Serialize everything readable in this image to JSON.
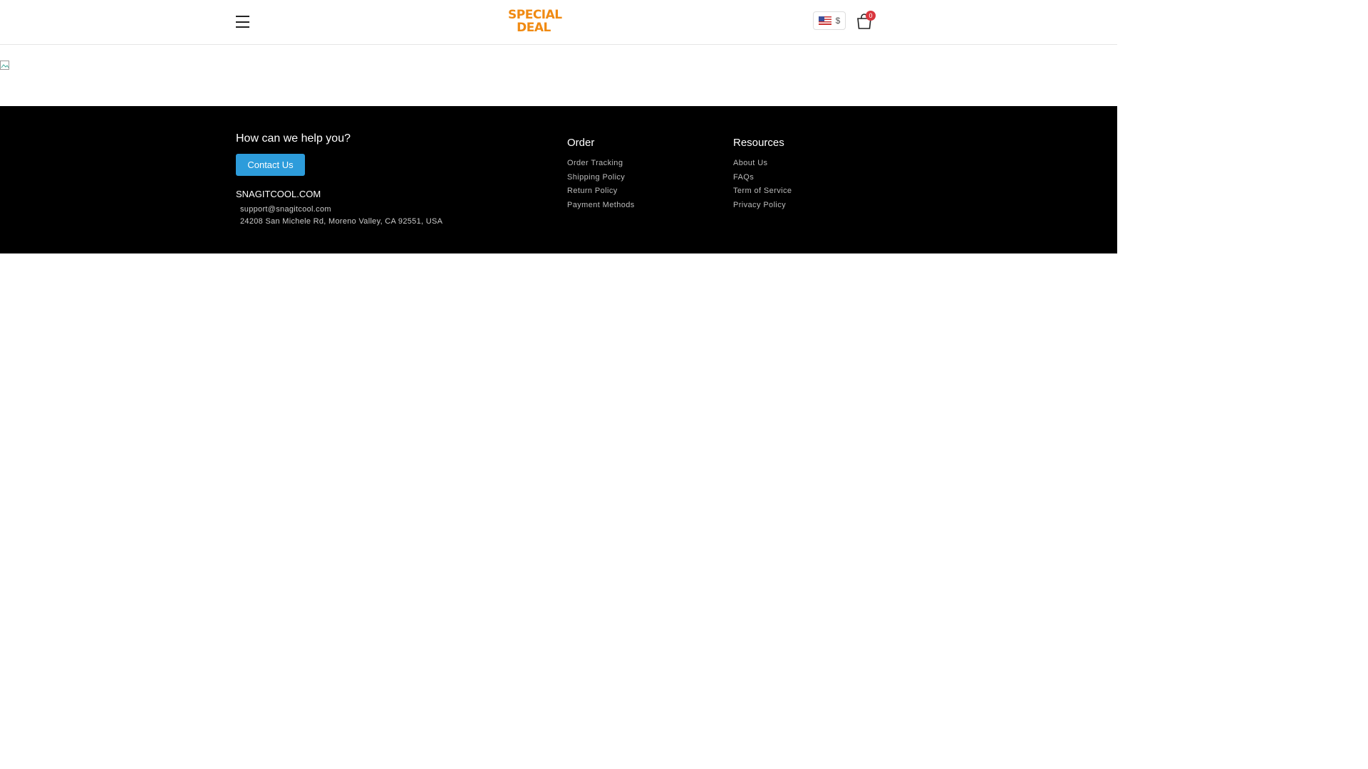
{
  "header": {
    "logo_text": [
      "SPECIAL",
      "DEAL"
    ],
    "currency_symbol": "$",
    "cart_count": "0"
  },
  "footer": {
    "help_heading": "How can we help you?",
    "contact_label": "Contact Us",
    "site_name": "SNAGITCOOL.COM",
    "email": "support@snagitcool.com",
    "address": "24208 San Michele Rd, Moreno Valley, CA 92551, USA",
    "order": {
      "title": "Order",
      "links": [
        "Order Tracking",
        "Shipping Policy",
        "Return Policy",
        "Payment Methods"
      ]
    },
    "resources": {
      "title": "Resources",
      "links": [
        "About Us",
        "FAQs",
        "Term of Service",
        "Privacy Policy"
      ]
    }
  },
  "colors": {
    "accent": "#2d9cdb",
    "badge": "#d9363e",
    "logo": "#f08a12"
  }
}
